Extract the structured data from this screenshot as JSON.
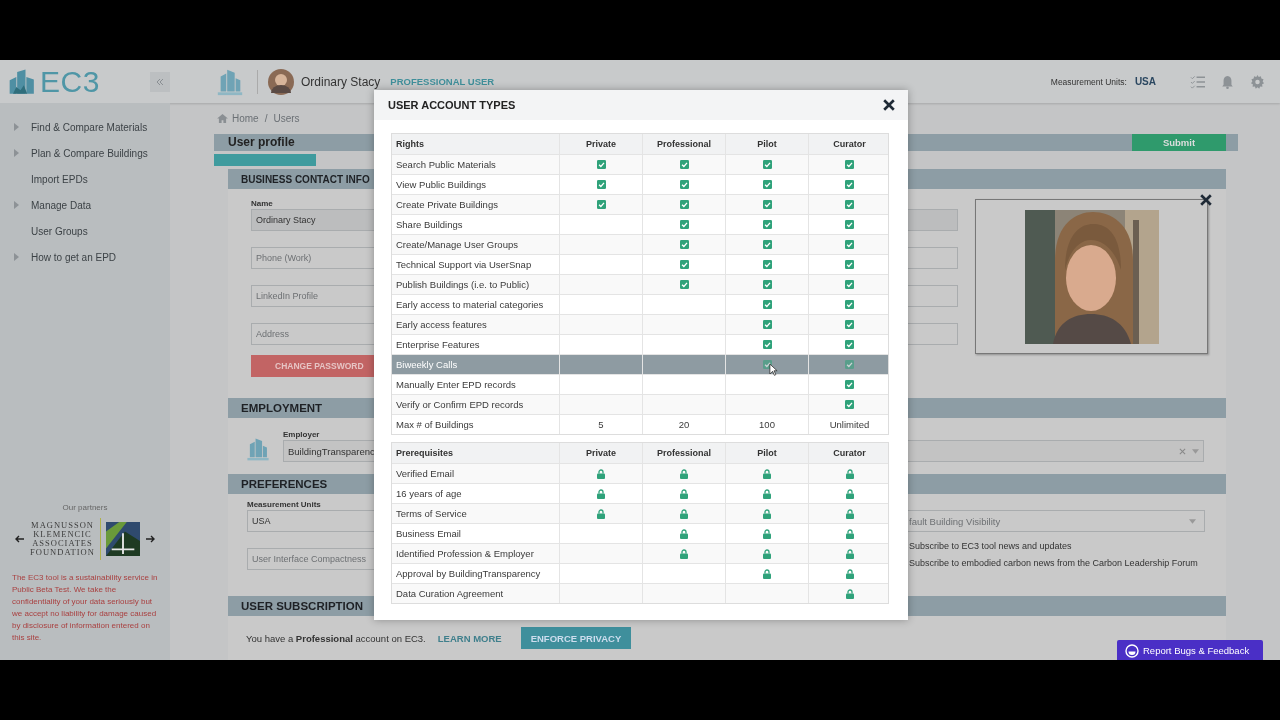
{
  "header": {
    "logo_text": "EC3",
    "user_name": "Ordinary Stacy",
    "user_role": "PROFESSIONAL USER",
    "units_label": "Measurement Units:",
    "units_value": "USA"
  },
  "sidebar": {
    "items": [
      {
        "label": "Find & Compare Materials",
        "expandable": true
      },
      {
        "label": "Plan & Compare Buildings",
        "expandable": true
      },
      {
        "label": "Import EPDs",
        "expandable": false
      },
      {
        "label": "Manage Data",
        "expandable": true
      },
      {
        "label": "User Groups",
        "expandable": false
      },
      {
        "label": "How to get an EPD",
        "expandable": true
      }
    ],
    "partners_title": "Our partners",
    "partner_logo_lines": [
      "MAGNUSSON",
      "KLEMENCIC",
      "ASSOCIATES",
      "FOUNDATION"
    ],
    "disclaimer": "The EC3 tool is a sustainability service in Public Beta Test. We take the confidentiality of your data seriously but we accept no liability for damage caused by disclosure of information entered on this site."
  },
  "breadcrumb": [
    "Home",
    "Users"
  ],
  "breadcrumb_separator": "/",
  "profile": {
    "title": "User profile",
    "submit": "Submit",
    "progress": {
      "level": 0.1
    }
  },
  "business": {
    "title": "BUSINESS CONTACT INFO",
    "name_label": "Name",
    "name_value": "Ordinary Stacy",
    "phone_placeholder": "Phone (Work)",
    "linkedin_placeholder": "LinkedIn Profile",
    "address_placeholder": "Address",
    "change_password": "CHANGE PASSWORD"
  },
  "employment": {
    "title": "EMPLOYMENT",
    "employer_label": "Employer",
    "employer_value": "BuildingTransparenc"
  },
  "preferences": {
    "title": "PREFERENCES",
    "units_label": "Measurement Units",
    "units_value": "USA",
    "compactness_placeholder": "User Interface Compactness",
    "visibility_placeholder": "fault Building Visibility",
    "subscriptions": [
      "Subscribe to EC3 tool news and updates",
      "Subscribe to embodied carbon news from the Carbon Leadership Forum"
    ]
  },
  "subscription": {
    "title": "USER SUBSCRIPTION",
    "message": "You have a **Professional** account on EC3.",
    "learn_more": "LEARN MORE",
    "enforce_privacy": "ENFORCE PRIVACY"
  },
  "feedback_button": "Report Bugs & Feedback",
  "modal": {
    "title": "USER ACCOUNT TYPES",
    "rights": {
      "heading": "Rights",
      "columns": [
        "Private",
        "Professional",
        "Pilot",
        "Curator"
      ],
      "rows": [
        {
          "label": "Search Public Materials",
          "highlighted": false,
          "cells": [
            true,
            true,
            true,
            true
          ]
        },
        {
          "label": "View Public Buildings",
          "highlighted": false,
          "cells": [
            true,
            true,
            true,
            true
          ]
        },
        {
          "label": "Create Private Buildings",
          "highlighted": false,
          "cells": [
            true,
            true,
            true,
            true
          ]
        },
        {
          "label": "Share Buildings",
          "highlighted": false,
          "cells": [
            false,
            true,
            true,
            true
          ]
        },
        {
          "label": "Create/Manage User Groups",
          "highlighted": false,
          "cells": [
            false,
            true,
            true,
            true
          ]
        },
        {
          "label": "Technical Support via UserSnap",
          "highlighted": false,
          "cells": [
            false,
            true,
            true,
            true
          ]
        },
        {
          "label": "Publish Buildings (i.e. to Public)",
          "highlighted": false,
          "cells": [
            false,
            true,
            true,
            true
          ]
        },
        {
          "label": "Early access to material categories",
          "highlighted": false,
          "cells": [
            false,
            false,
            true,
            true
          ]
        },
        {
          "label": "Early access features",
          "highlighted": false,
          "cells": [
            false,
            false,
            true,
            true
          ]
        },
        {
          "label": "Enterprise Features",
          "highlighted": false,
          "cells": [
            false,
            false,
            true,
            true
          ]
        },
        {
          "label": "Biweekly Calls",
          "highlighted": true,
          "cells": [
            false,
            false,
            true,
            true
          ]
        },
        {
          "label": "Manually Enter EPD records",
          "highlighted": false,
          "cells": [
            false,
            false,
            false,
            true
          ]
        },
        {
          "label": "Verify or Confirm EPD records",
          "highlighted": false,
          "cells": [
            false,
            false,
            false,
            true
          ]
        }
      ],
      "max_row": {
        "label": "Max # of Buildings",
        "values": [
          "5",
          "20",
          "100",
          "Unlimited"
        ]
      }
    },
    "prerequisites": {
      "heading": "Prerequisites",
      "columns": [
        "Private",
        "Professional",
        "Pilot",
        "Curator"
      ],
      "rows": [
        {
          "label": "Verified Email",
          "cells": [
            true,
            true,
            true,
            true
          ]
        },
        {
          "label": "16 years of age",
          "cells": [
            true,
            true,
            true,
            true
          ]
        },
        {
          "label": "Terms of Service",
          "cells": [
            true,
            true,
            true,
            true
          ]
        },
        {
          "label": "Business Email",
          "cells": [
            false,
            true,
            true,
            true
          ]
        },
        {
          "label": "Identified Profession & Employer",
          "cells": [
            false,
            true,
            true,
            true
          ]
        },
        {
          "label": "Approval by BuildingTransparency",
          "cells": [
            false,
            false,
            true,
            true
          ]
        },
        {
          "label": "Data Curation Agreement",
          "cells": [
            false,
            false,
            false,
            true
          ]
        }
      ]
    }
  }
}
